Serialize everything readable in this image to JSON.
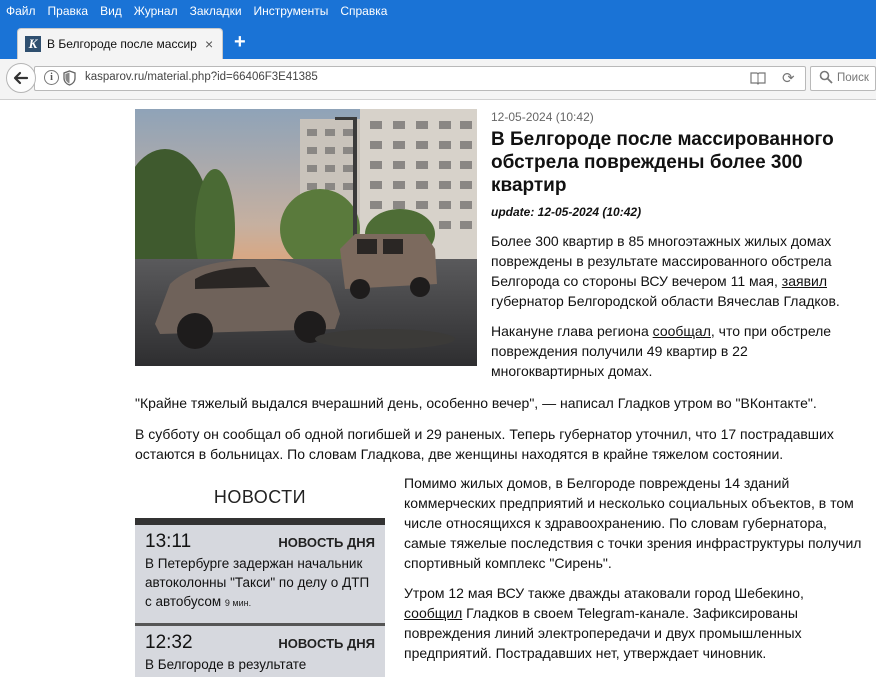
{
  "browser": {
    "menu": [
      "Файл",
      "Правка",
      "Вид",
      "Журнал",
      "Закладки",
      "Инструменты",
      "Справка"
    ],
    "tab_title": "В Белгороде после массиро...",
    "tab_close": "×",
    "new_tab": "+",
    "url": "kasparov.ru/material.php?id=66406F3E41385",
    "search_placeholder": "Поиск",
    "favicon_letter": "K",
    "accent": "#1a73d6"
  },
  "article": {
    "date": "12-05-2024 (10:42)",
    "title": "В Белгороде после массированного обстрела повреждены более 300 квартир",
    "update": "update: 12-05-2024 (10:42)",
    "p1_a": "Более 300 квартир в 85 многоэтажных жилых домах повреждены в результате массированного обстрела Белгорода со стороны ВСУ вечером 11 мая, ",
    "p1_link": "заявил",
    "p1_b": " губернатор Белгородской области Вячеслав Гладков.",
    "p2_a": "Накануне глава региона ",
    "p2_link": "сообщал",
    "p2_b": ", что при обстреле повреждения получили 49 квартир в 22 многоквартирных домах.",
    "p3": "\"Крайне тяжелый выдался вчерашний день, особенно вечер\", — написал Гладков утром во \"ВКонтакте\".",
    "p4": "В субботу он сообщал об одной погибшей и 29 раненых. Теперь губернатор уточнил, что 17 пострадавших остаются в больницах. По словам Гладкова, две женщины находятся в крайне тяжелом состоянии.",
    "p5": "Помимо жилых домов, в Белгороде повреждены 14 зданий коммерческих предприятий и несколько социальных объектов, в том числе относящихся к здравоохранению. По словам губернатора, самые тяжелые последствия с точки зрения инфраструктуры получил спортивный комплекс \"Сирень\".",
    "p6_a": "Утром 12 мая ВСУ также дважды атаковали город Шебекино, ",
    "p6_link": "сообщил",
    "p6_b": " Гладков в своем Telegram-канале. Зафиксированы повреждения линий электропередачи и двух промышленных предприятий. Пострадавших нет, утверждает чиновник."
  },
  "news": {
    "heading": "НОВОСТИ",
    "items": [
      {
        "time": "13:11",
        "badge": "НОВОСТЬ ДНЯ",
        "text": "В Петербурге задержан начальник автоколонны \"Такси\" по делу о ДТП с автобусом",
        "ago": "9 мин."
      },
      {
        "time": "12:32",
        "badge": "НОВОСТЬ ДНЯ",
        "text": "В Белгороде в результате"
      }
    ]
  }
}
